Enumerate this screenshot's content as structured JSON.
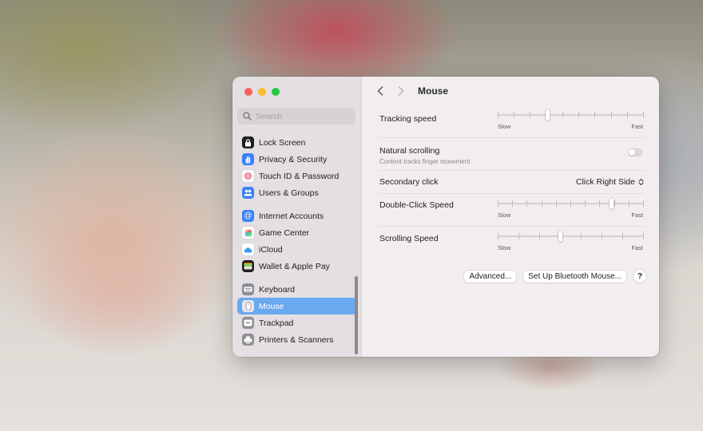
{
  "window": {
    "title": "Mouse"
  },
  "sidebar": {
    "search_placeholder": "Search",
    "groups": [
      [
        {
          "label": "Lock Screen",
          "icon": "lock-icon",
          "color": "#1f1f1f"
        },
        {
          "label": "Privacy & Security",
          "icon": "hand-icon",
          "color": "#3b82f6"
        },
        {
          "label": "Touch ID & Password",
          "icon": "fingerprint-icon",
          "color": "#ffffff"
        },
        {
          "label": "Users & Groups",
          "icon": "users-icon",
          "color": "#3b82f6"
        }
      ],
      [
        {
          "label": "Internet Accounts",
          "icon": "at-icon",
          "color": "#3b82f6"
        },
        {
          "label": "Game Center",
          "icon": "game-center-icon",
          "color": "#ffffff"
        },
        {
          "label": "iCloud",
          "icon": "cloud-icon",
          "color": "#ffffff"
        },
        {
          "label": "Wallet & Apple Pay",
          "icon": "wallet-icon",
          "color": "#1f1f1f"
        }
      ],
      [
        {
          "label": "Keyboard",
          "icon": "keyboard-icon",
          "color": "#8e8e93"
        },
        {
          "label": "Mouse",
          "icon": "mouse-icon",
          "color": "#8e8e93",
          "active": true
        },
        {
          "label": "Trackpad",
          "icon": "trackpad-icon",
          "color": "#8e8e93"
        },
        {
          "label": "Printers & Scanners",
          "icon": "printer-icon",
          "color": "#8e8e93"
        }
      ]
    ]
  },
  "settings": {
    "tracking_speed": {
      "label": "Tracking speed",
      "min_label": "Slow",
      "max_label": "Fast",
      "value": 0.34,
      "ticks": 10
    },
    "natural_scrolling": {
      "label": "Natural scrolling",
      "sublabel": "Content tracks finger movement",
      "enabled": false
    },
    "secondary_click": {
      "label": "Secondary click",
      "value": "Click Right Side"
    },
    "double_click_speed": {
      "label": "Double-Click Speed",
      "min_label": "Slow",
      "max_label": "Fast",
      "value": 0.78,
      "ticks": 11
    },
    "scrolling_speed": {
      "label": "Scrolling Speed",
      "min_label": "Slow",
      "max_label": "Fast",
      "value": 0.43,
      "ticks": 8
    }
  },
  "buttons": {
    "advanced": "Advanced...",
    "bluetooth": "Set Up Bluetooth Mouse...",
    "help": "?"
  },
  "colors": {
    "accent": "#6aa8f0",
    "close": "#fe5f57",
    "minimize": "#febc2e",
    "maximize": "#28c840"
  }
}
